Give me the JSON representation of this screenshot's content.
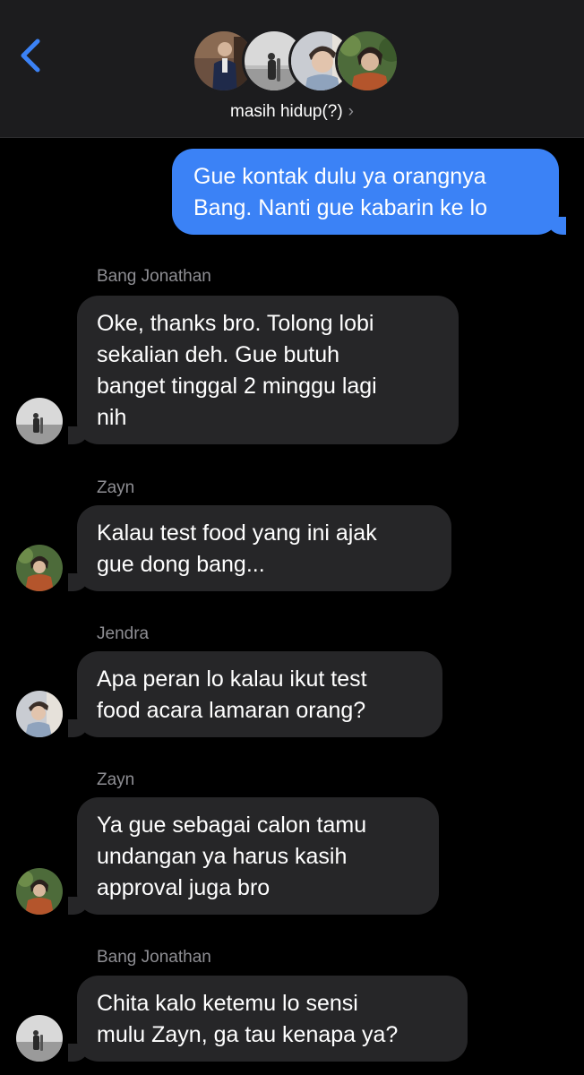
{
  "header": {
    "group_name": "masih hidup(?)",
    "chevron": "›",
    "back_icon": "chevron-left-icon",
    "accent_color": "#3b82f6"
  },
  "messages": [
    {
      "direction": "outgoing",
      "lines": [
        "Gue kontak dulu ya orangnya",
        "Bang. Nanti gue kabarin ke lo"
      ]
    },
    {
      "direction": "incoming",
      "sender": "Bang Jonathan",
      "lines": [
        "Oke, thanks bro. Tolong lobi",
        "sekalian deh. Gue butuh",
        "banget tinggal 2 minggu lagi",
        "nih"
      ]
    },
    {
      "direction": "incoming",
      "sender": "Zayn",
      "lines": [
        "Kalau test food yang ini ajak",
        "gue dong bang..."
      ]
    },
    {
      "direction": "incoming",
      "sender": "Jendra",
      "lines": [
        "Apa peran lo kalau ikut test",
        "food acara lamaran orang?"
      ]
    },
    {
      "direction": "incoming",
      "sender": "Zayn",
      "lines": [
        "Ya gue sebagai calon tamu",
        "undangan ya harus kasih",
        "approval juga bro"
      ]
    },
    {
      "direction": "incoming",
      "sender": "Bang Jonathan",
      "lines": [
        "Chita kalo ketemu lo sensi",
        "mulu Zayn, ga tau kenapa ya?"
      ]
    }
  ]
}
